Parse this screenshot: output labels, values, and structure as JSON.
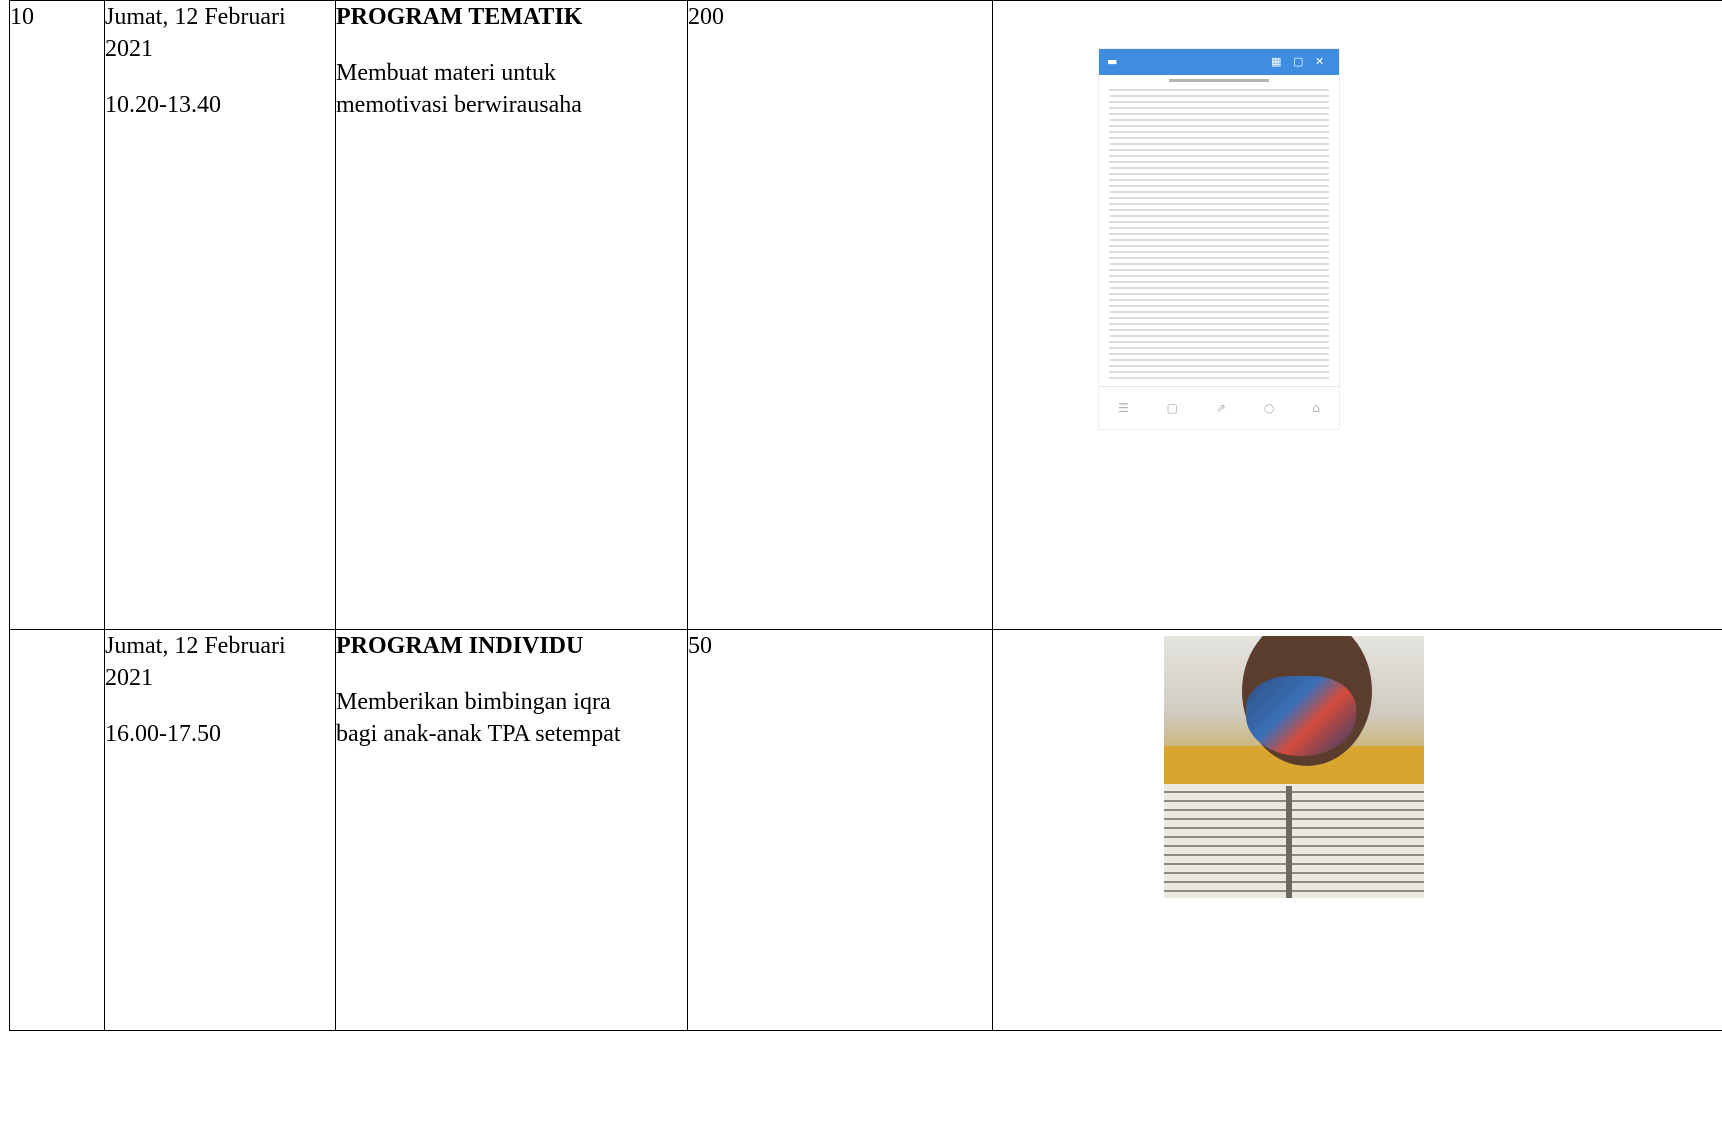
{
  "rows": [
    {
      "number": "10",
      "date_line1": "Jumat, 12 Februari",
      "date_line2": "2021",
      "time": "10.20-13.40",
      "program_title": "PROGRAM TEMATIK",
      "program_desc_line1": "Membuat materi untuk",
      "program_desc_line2": "memotivasi berwirausaha",
      "duration": "200",
      "image": "document-screenshot"
    },
    {
      "number": "",
      "date_line1": "Jumat, 12 Februari",
      "date_line2": "2021",
      "time": "16.00-17.50",
      "program_title": "PROGRAM INDIVIDU",
      "program_desc_line1": "Memberikan bimbingan iqra",
      "program_desc_line2": "bagi anak-anak TPA setempat",
      "duration": "50",
      "image": "photo-child-reading-iqra"
    }
  ],
  "colors": {
    "border": "#000000",
    "doc_toolbar": "#3f8de0",
    "shirt": "#d8a62f"
  }
}
